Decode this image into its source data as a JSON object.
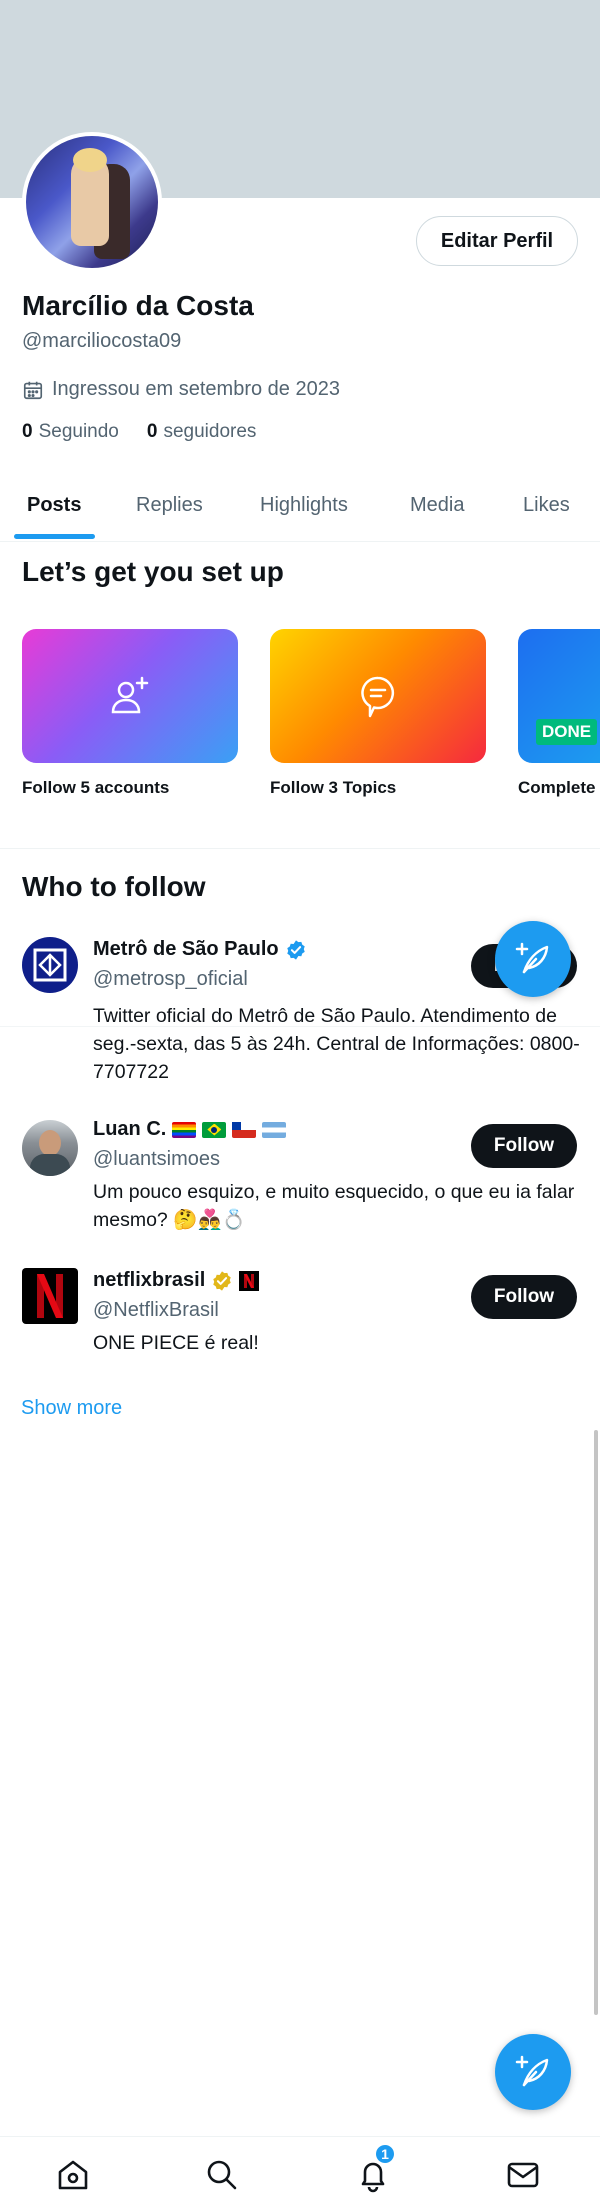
{
  "profile": {
    "name": "Marcílio da Costa",
    "handle": "@marciliocosta09",
    "joined": "Ingressou em setembro de 2023",
    "following_count": "0",
    "following_label": "Seguindo",
    "followers_count": "0",
    "followers_label": "seguidores",
    "edit_label": "Editar Perfil"
  },
  "tabs": [
    {
      "label": "Posts",
      "active": true
    },
    {
      "label": "Replies"
    },
    {
      "label": "Highlights"
    },
    {
      "label": "Media"
    },
    {
      "label": "Likes"
    }
  ],
  "setup": {
    "title": "Let’s get you set up",
    "cards": [
      {
        "label": "Follow 5 accounts",
        "icon": "person-add-icon"
      },
      {
        "label": "Follow 3 Topics",
        "icon": "topic-bubble-icon"
      },
      {
        "label": "Complete",
        "badge": "DONE"
      }
    ]
  },
  "who_to_follow": {
    "title": "Who to follow",
    "users": [
      {
        "name": "Metrô de São Paulo",
        "handle": "@metrosp_oficial",
        "bio": "Twitter oficial do Metrô de São Paulo. Atendimento de seg.-sexta, das 5 às 24h. Central de Informações: 0800-7707722",
        "verified": "blue",
        "follow_label": "Follow"
      },
      {
        "name": "Luan C.",
        "handle": "@luantsimoes",
        "bio": "Um pouco esquizo, e muito esquecido, o que eu ia falar mesmo? 🤔👨‍❤️‍👨💍",
        "follow_label": "Follow"
      },
      {
        "name": "netflixbrasil",
        "handle": "@NetflixBrasil",
        "bio": "ONE PIECE é real!",
        "verified": "gold",
        "follow_label": "Follow"
      }
    ],
    "show_more": "Show more"
  },
  "nav": {
    "items": [
      "home-icon",
      "search-icon",
      "notifications-icon",
      "messages-icon"
    ],
    "notification_count": "1"
  },
  "colors": {
    "accent": "#1d9bf0",
    "banner": "#cfd9de",
    "text_secondary": "#536471"
  }
}
